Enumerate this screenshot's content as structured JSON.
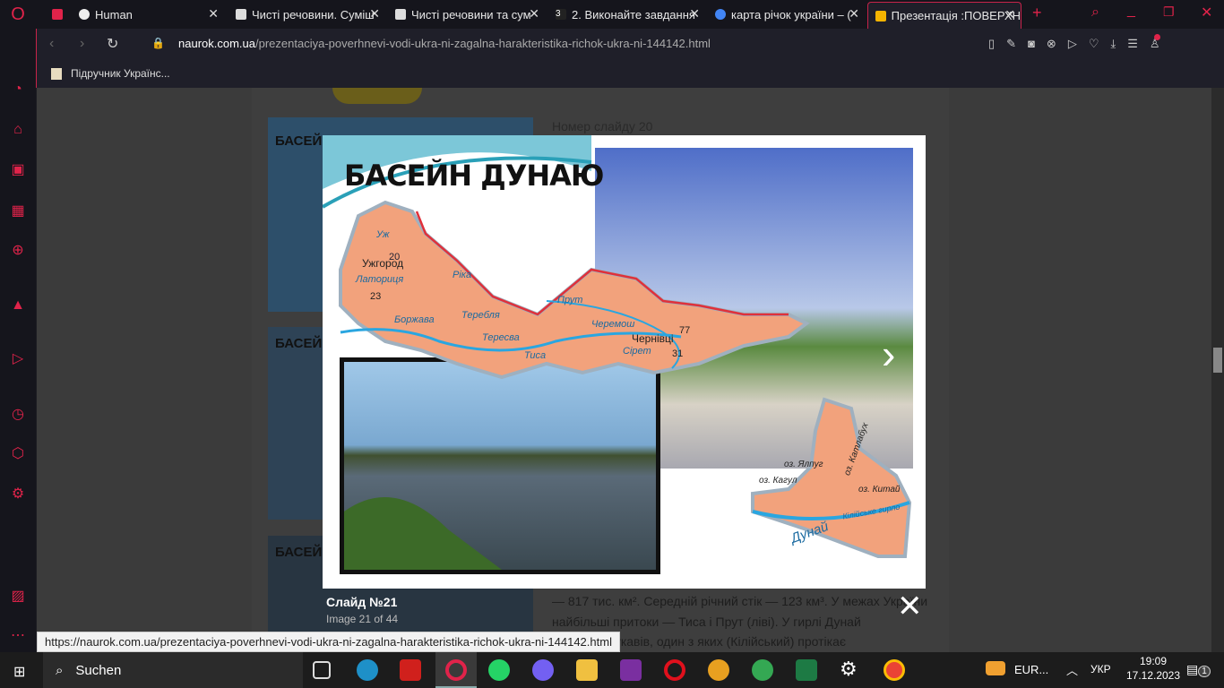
{
  "browser": {
    "tabs": [
      {
        "title": "Human",
        "active": false
      },
      {
        "title": "Чисті речовини. Суміш",
        "active": false
      },
      {
        "title": "Чисті речовини та сум",
        "active": false
      },
      {
        "title": "2. Виконайте завдання",
        "active": false
      },
      {
        "title": "карта річок україни – (",
        "active": false
      },
      {
        "title": "Презентація :ПОВЕРХН",
        "active": true
      }
    ],
    "url_domain": "naurok.com.ua",
    "url_path": "/prezentaciya-poverhnevi-vodi-ukra-ni-zagalna-harakteristika-richok-ukra-ni-144142.html",
    "bookmark": "Підручник Українс...",
    "status_url": "https://naurok.com.ua/prezentaciya-poverhnevi-vodi-ukra-ni-zagalna-harakteristika-richok-ukra-ni-144142.html",
    "accent": "#e0234a"
  },
  "page": {
    "slide_number_label": "Номер слайду 20",
    "thumb_title": "БАСЕЙН",
    "text_lines": [
      "— 817 тис. км². Середній річний стік — 123 км³. У межах України",
      "найбільші притоки — Тиса і Прут (ліві). У гирлі Дунай",
      "на кілька рукавів, один з яких (Кілійський) протікає"
    ]
  },
  "lightbox": {
    "slide_title": "БАСЕЙН ДУНАЮ",
    "map_labels": {
      "uzhhorod": "Ужгород",
      "uzh": "Уж",
      "latorytsia": "Латориця",
      "n20": "20",
      "n23": "23",
      "borzhava": "Боржава",
      "rika": "Ріка",
      "tereblia": "Теребля",
      "teresva": "Тересва",
      "prut": "Прут",
      "cheremosh": "Черемош",
      "chernivtsi": "Чернівці",
      "n77": "77",
      "n31": "31",
      "siret": "Сірет",
      "tysa": "Тиса"
    },
    "delta_labels": {
      "yalpuh": "оз. Ялпуг",
      "katlabukh": "оз. Катлабух",
      "kahul": "оз. Кагул",
      "kytai": "оз. Китай",
      "dunai": "Дунай",
      "kiliia": "Кілійське гирло"
    },
    "caption_title": "Слайд №21",
    "caption_count": "Image 21 of 44"
  },
  "taskbar": {
    "search": "Suchen",
    "tray_app": "EUR...",
    "lang": "УКР",
    "time": "19:09",
    "date": "17.12.2023",
    "notifications": "1"
  }
}
